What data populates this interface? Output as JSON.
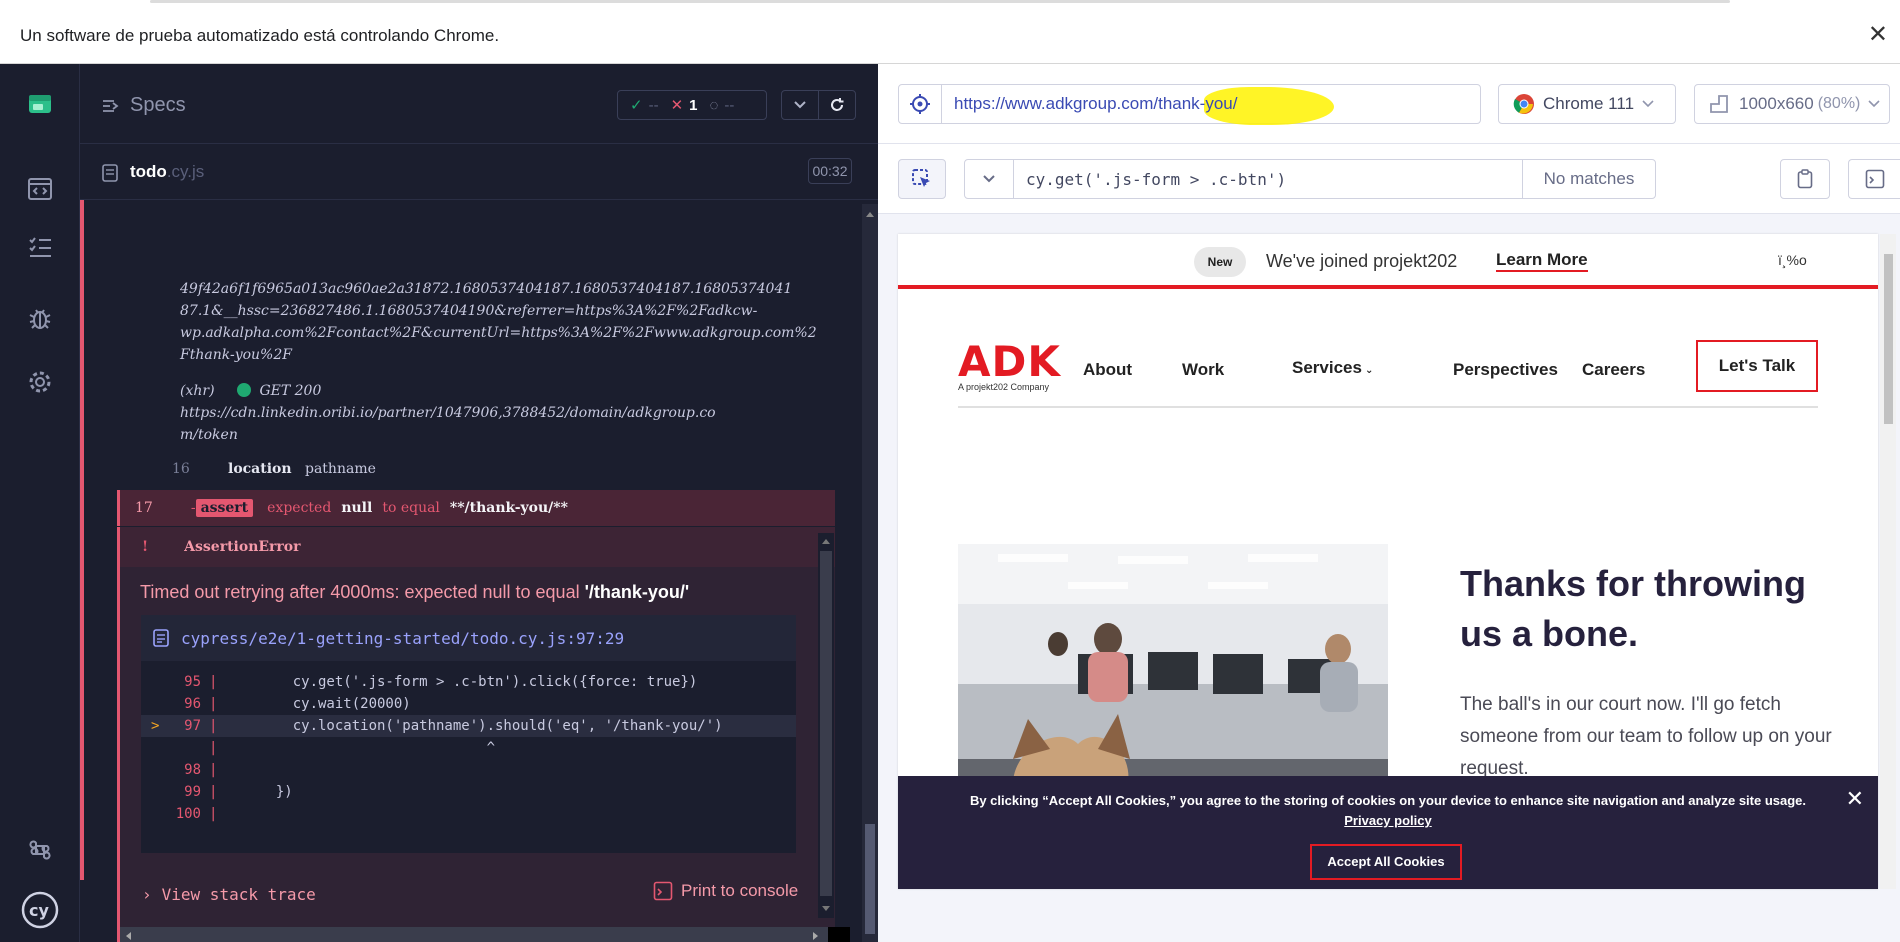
{
  "browser": {
    "infobar_message": "Un software de prueba automatizado está controlando Chrome."
  },
  "reporter": {
    "specs_label": "Specs",
    "stats": {
      "passed": "--",
      "failed": "1",
      "pending": "--"
    },
    "spec_name": "todo",
    "spec_ext": ".cy.js",
    "duration": "00:32",
    "log_lines_top": [
      "49f42a6f1f6965a013ac960ae2a31872.1680537404187.1680537404187.16805374041",
      "87.1&__hssc=236827486.1.1680537404190&referrer=https%3A%2F%2Fadkcw-",
      "wp.adkalpha.com%2Fcontact%2F&currentUrl=https%3A%2F%2Fwww.adkgroup.com%2",
      "Fthank-you%2F"
    ],
    "xhr": {
      "label": "(xhr)",
      "method_status": "GET 200",
      "url_lines": [
        "https://cdn.linkedin.oribi.io/partner/1047906,3788452/domain/adkgroup.co",
        "m/token"
      ]
    },
    "cmd16": {
      "num": "16",
      "name": "location",
      "arg": "pathname"
    },
    "cmd17": {
      "num": "17",
      "prefix": "-",
      "badge": "assert",
      "w1": "expected",
      "w2": "null",
      "w3": "to equal",
      "w4": "**/thank-you/**"
    },
    "error": {
      "bang": "!",
      "name": "AssertionError",
      "message_prefix": "Timed out retrying after 4000ms: expected null to equal ",
      "message_value": "'/thank-you/'",
      "file_path": "cypress/e2e/1-getting-started/todo.cy.js:97:29",
      "code_lines": [
        {
          "num": "95",
          "marker": "",
          "code": "    cy.get('.js-form > .c-btn').click({force: true})"
        },
        {
          "num": "96",
          "marker": "",
          "code": "    cy.wait(20000)"
        },
        {
          "num": "97",
          "marker": ">",
          "code": "    cy.location('pathname').should('eq', '/thank-you/')"
        },
        {
          "num": "",
          "marker": "",
          "code": "                           ^"
        },
        {
          "num": "98",
          "marker": "",
          "code": ""
        },
        {
          "num": "99",
          "marker": "",
          "code": "  })"
        },
        {
          "num": "100",
          "marker": "",
          "code": ""
        }
      ],
      "view_stack": "View stack trace",
      "print_console": "Print to console"
    }
  },
  "app": {
    "url": "https://www.adkgroup.com/thank-you/",
    "browser_name": "Chrome 111",
    "viewport": "1000x660",
    "zoom": "(80%)",
    "selector_value": "cy.get('.js-form > .c-btn')",
    "selector_status": "No matches"
  },
  "site": {
    "banner_badge": "New",
    "banner_text": "We've joined projekt202",
    "banner_link": "Learn More",
    "banner_odd": "ï¸%o",
    "logo_text": "ADK",
    "logo_sub": "A projekt202 Company",
    "nav": [
      "About",
      "Work",
      "Services",
      "Perspectives",
      "Careers"
    ],
    "cta": "Let's Talk",
    "hero_title": "Thanks for throwing us a bone.",
    "hero_body": "The ball's in our court now. I'll go fetch someone from our team to follow up on your request.",
    "cookie_text": "By clicking “Accept All Cookies,” you agree to the storing of cookies on your device to enhance site navigation and analyze site usage.",
    "cookie_link": "Privacy policy",
    "cookie_accept": "Accept All Cookies"
  },
  "colors": {
    "cypress_bg": "#1b1e2e",
    "error": "#e45770",
    "adk_red": "#e31b23",
    "adk_navy": "#26213d"
  }
}
